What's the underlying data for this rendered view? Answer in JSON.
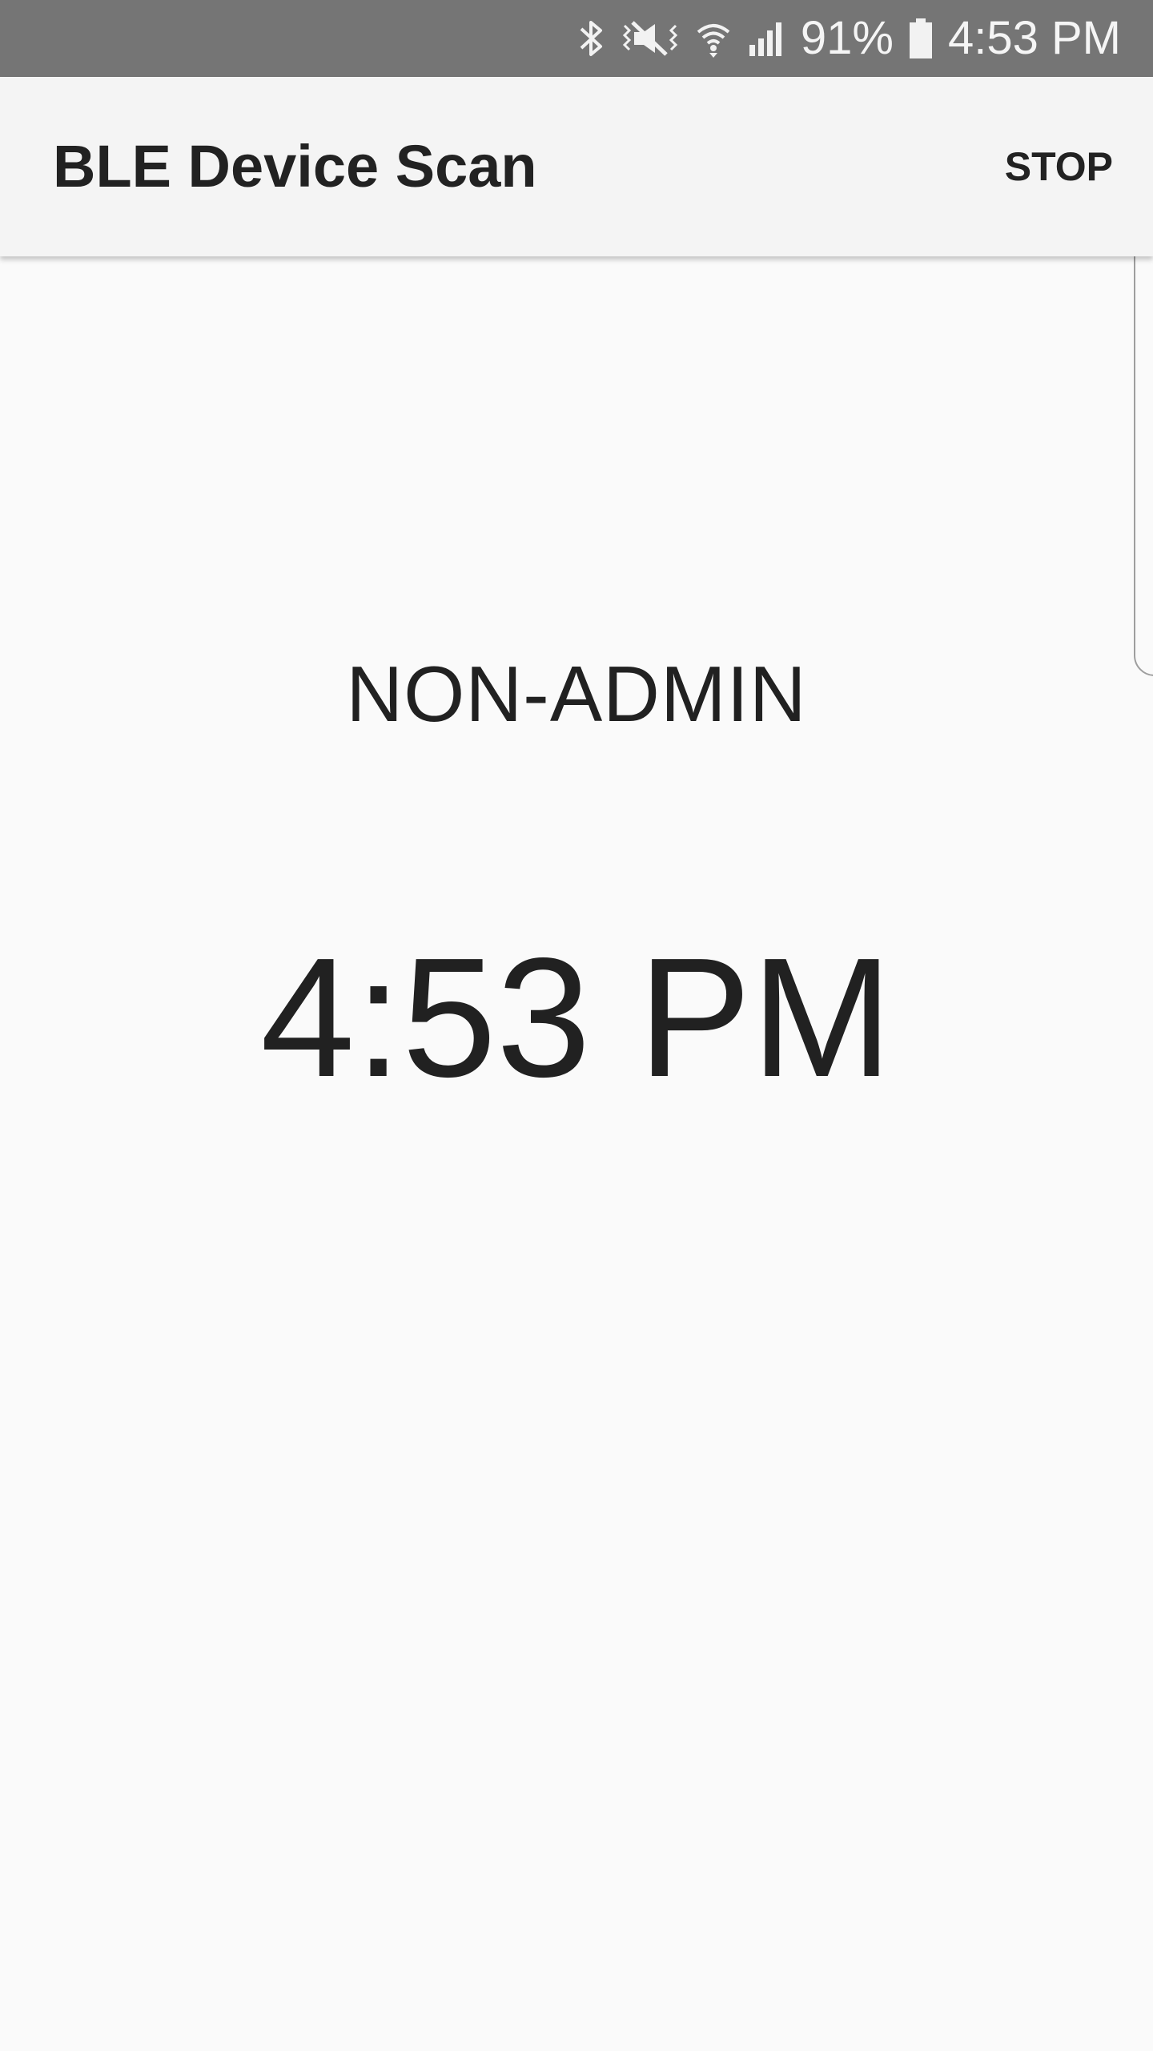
{
  "status_bar": {
    "icons": [
      "bluetooth-icon",
      "vibrate-mute-icon",
      "wifi-icon",
      "cell-signal-icon",
      "battery-icon"
    ],
    "battery_percent": "91%",
    "time": "4:53 PM"
  },
  "app_bar": {
    "title": "BLE Device Scan",
    "stop_label": "STOP"
  },
  "content": {
    "role": "NON-ADMIN",
    "clock": "4:53 PM"
  }
}
